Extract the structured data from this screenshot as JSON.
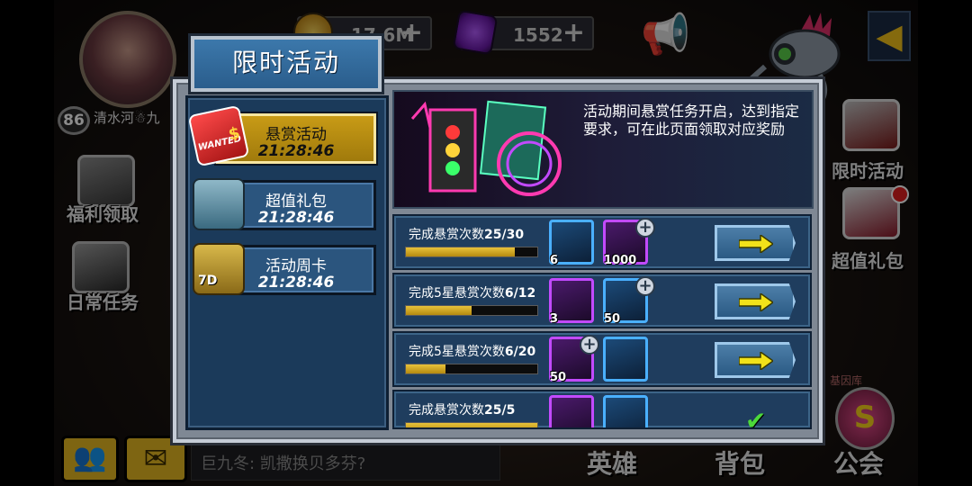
{
  "hud": {
    "player_level": "86",
    "player_name": "清水河☃九",
    "gold": "17.6M",
    "gems": "1552"
  },
  "side_menu": {
    "fuli": "福利领取",
    "richang": "日常任务",
    "xianshi": "限时活动",
    "chaozhi": "超值礼包",
    "gene": "基因库"
  },
  "bottom": {
    "chat_message": "巨九冬: 凯撒换贝多芬?",
    "tab_heroes": "英雄",
    "tab_backpack": "背包",
    "tab_guild": "公会",
    "guild_letter": "S"
  },
  "modal": {
    "title": "限时活动",
    "tabs": [
      {
        "label": "悬赏活动",
        "timer": "21:28:46",
        "active": true
      },
      {
        "label": "超值礼包",
        "timer": "21:28:46",
        "active": false
      },
      {
        "label": "活动周卡",
        "timer": "21:28:46",
        "active": false
      }
    ],
    "tab_badges": {
      "wanted": "WANTED",
      "dollar": "$",
      "days": "7D"
    },
    "banner_text": "活动期间悬赏任务开启，达到指定要求，可在此页面领取对应奖励",
    "tasks": [
      {
        "prefix": "完成悬赏次数",
        "count": "25/30",
        "progress": 0.83,
        "rewards": [
          {
            "qty": "6",
            "color": "blue"
          },
          {
            "qty": "1000",
            "color": "purple",
            "plus": true
          }
        ],
        "state": "go"
      },
      {
        "prefix": "完成5星悬赏次数",
        "count": "6/12",
        "progress": 0.5,
        "rewards": [
          {
            "qty": "3",
            "color": "purple"
          },
          {
            "qty": "50",
            "color": "blue",
            "plus": true
          }
        ],
        "state": "go"
      },
      {
        "prefix": "完成5星悬赏次数",
        "count": "6/20",
        "progress": 0.3,
        "rewards": [
          {
            "qty": "50",
            "color": "purple",
            "plus": true
          },
          {
            "qty": "",
            "color": "blue"
          }
        ],
        "state": "go"
      },
      {
        "prefix": "完成悬赏次数",
        "count": "25/5",
        "progress": 1.0,
        "rewards": [
          {
            "qty": "",
            "color": "purple"
          },
          {
            "qty": "",
            "color": "blue"
          }
        ],
        "state": "done"
      }
    ]
  },
  "colors": {
    "accent_gold": "#c89b16",
    "panel_blue": "#1f3d5e",
    "check_green": "#4cd93a"
  }
}
